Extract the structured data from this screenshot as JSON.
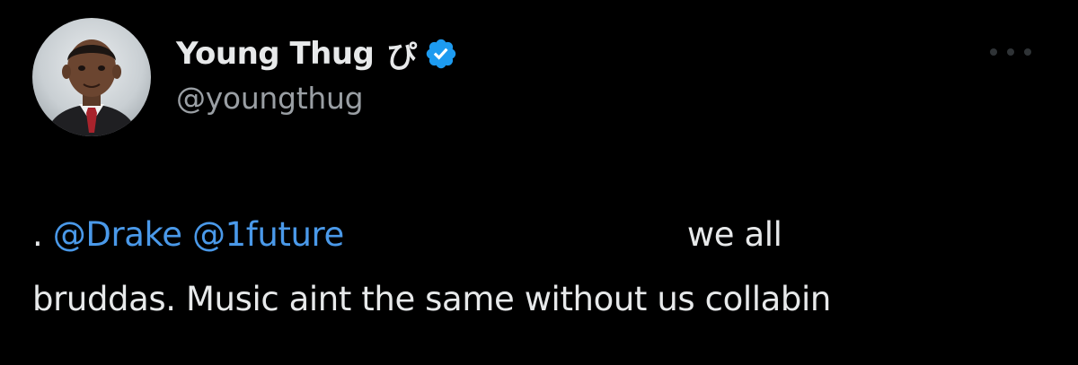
{
  "tweet": {
    "display_name": "Young Thug",
    "name_emoji": "ぴ",
    "handle": "@youngthug",
    "body": {
      "lead": ".",
      "mention_1": "@Drake",
      "mention_2": "@1future",
      "line1_tail": "we all",
      "line2": "bruddas. Music aint the same without us collabin"
    }
  },
  "colors": {
    "background": "#000000",
    "text": "#e7e9ea",
    "secondary": "#9a9fa4",
    "mention": "#4a99e9",
    "verified": "#1d9bf0"
  },
  "icons": {
    "verified": "verified-badge-icon",
    "more": "more-options-icon"
  }
}
